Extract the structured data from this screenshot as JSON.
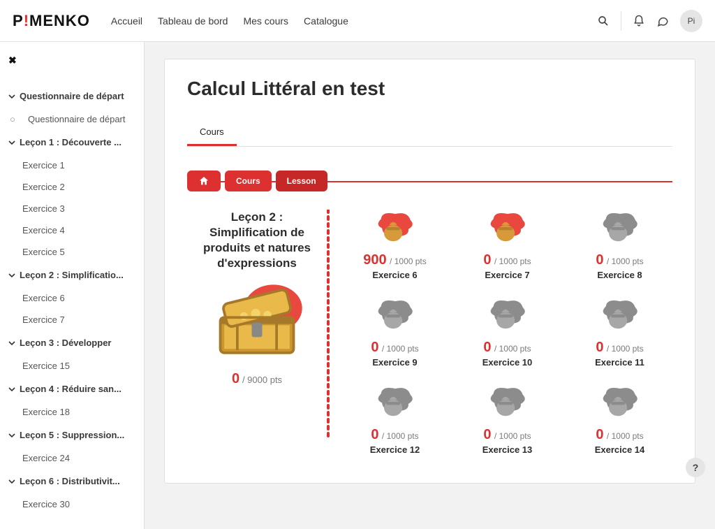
{
  "header": {
    "logo_before": "P",
    "logo_bang": "!",
    "logo_after": "MENKO",
    "nav": [
      "Accueil",
      "Tableau de bord",
      "Mes cours",
      "Catalogue"
    ],
    "avatar": "Pi"
  },
  "sidebar": {
    "sections": [
      {
        "title": "Questionnaire de départ",
        "items": [
          {
            "label": "Questionnaire de départ",
            "bullet": true
          }
        ]
      },
      {
        "title": "Leçon 1 : Découverte ...",
        "items": [
          {
            "label": "Exercice 1"
          },
          {
            "label": "Exercice 2"
          },
          {
            "label": "Exercice 3"
          },
          {
            "label": "Exercice 4"
          },
          {
            "label": "Exercice 5"
          }
        ]
      },
      {
        "title": "Leçon 2 : Simplificatio...",
        "items": [
          {
            "label": "Exercice 6"
          },
          {
            "label": "Exercice 7"
          }
        ]
      },
      {
        "title": "Leçon 3 : Développer",
        "items": [
          {
            "label": "Exercice 15"
          }
        ]
      },
      {
        "title": "Leçon 4 : Réduire san...",
        "items": [
          {
            "label": "Exercice 18"
          }
        ]
      },
      {
        "title": "Leçon 5 : Suppression...",
        "items": [
          {
            "label": "Exercice 24"
          }
        ]
      },
      {
        "title": "Leçon 6 : Distributivit...",
        "items": [
          {
            "label": "Exercice 30"
          }
        ]
      }
    ]
  },
  "page": {
    "title": "Calcul Littéral en test",
    "tab": "Cours",
    "bc_home_sr": "Home",
    "bc": [
      "Cours",
      "Lesson"
    ],
    "lesson": {
      "title": "Leçon 2 : Simplification de produits et natures d'expressions",
      "score": "0",
      "max": "/ 9000 pts"
    },
    "exercises": [
      {
        "name": "Exercice 6",
        "score": "900",
        "max": "/ 1000 pts",
        "done": true
      },
      {
        "name": "Exercice 7",
        "score": "0",
        "max": "/ 1000 pts",
        "done": true
      },
      {
        "name": "Exercice 8",
        "score": "0",
        "max": "/ 1000 pts",
        "done": false
      },
      {
        "name": "Exercice 9",
        "score": "0",
        "max": "/ 1000 pts",
        "done": false
      },
      {
        "name": "Exercice 10",
        "score": "0",
        "max": "/ 1000 pts",
        "done": false
      },
      {
        "name": "Exercice 11",
        "score": "0",
        "max": "/ 1000 pts",
        "done": false
      },
      {
        "name": "Exercice 12",
        "score": "0",
        "max": "/ 1000 pts",
        "done": false
      },
      {
        "name": "Exercice 13",
        "score": "0",
        "max": "/ 1000 pts",
        "done": false
      },
      {
        "name": "Exercice 14",
        "score": "0",
        "max": "/ 1000 pts",
        "done": false
      }
    ]
  },
  "help": "?"
}
